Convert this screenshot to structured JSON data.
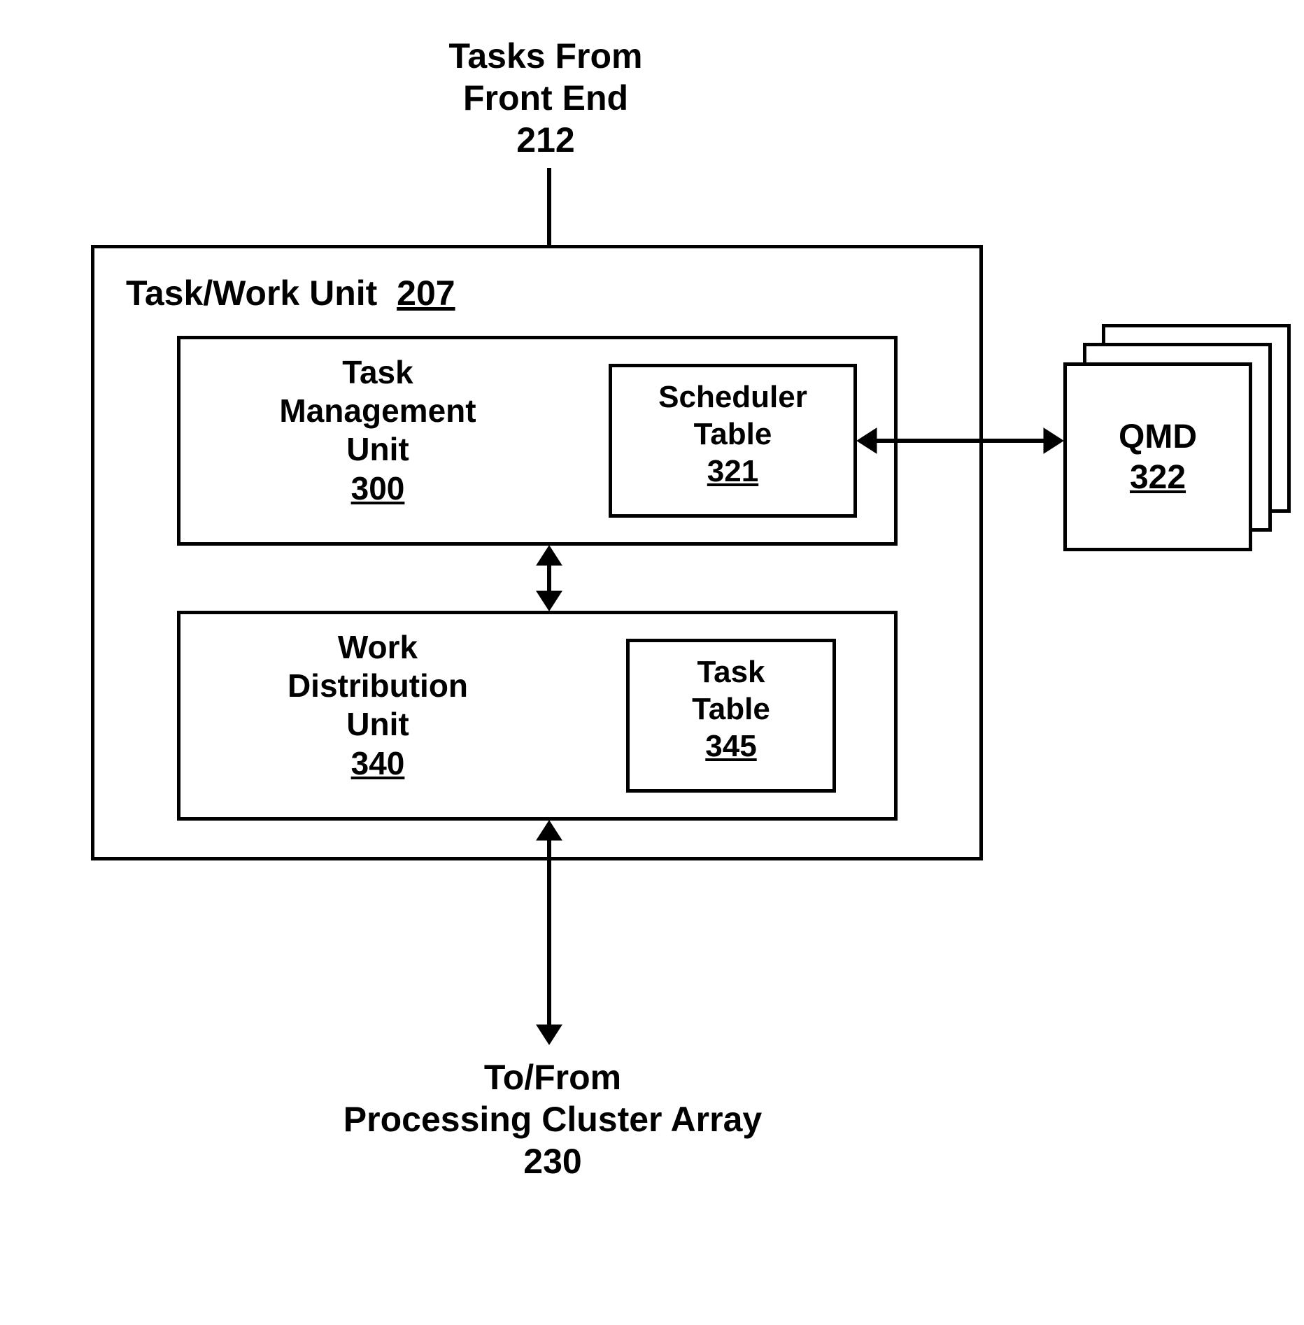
{
  "top_label": {
    "line1": "Tasks From",
    "line2": "Front End",
    "num": "212"
  },
  "bottom_label": {
    "line1": "To/From",
    "line2": "Processing Cluster Array",
    "num": "230"
  },
  "task_work_unit": {
    "title": "Task/Work Unit",
    "num": "207"
  },
  "tmu": {
    "line1": "Task",
    "line2": "Management",
    "line3": "Unit",
    "num": "300"
  },
  "sched": {
    "line1": "Scheduler",
    "line2": "Table",
    "num": "321"
  },
  "wdu": {
    "line1": "Work",
    "line2": "Distribution",
    "line3": "Unit",
    "num": "340"
  },
  "tasktable": {
    "line1": "Task",
    "line2": "Table",
    "num": "345"
  },
  "qmd": {
    "title": "QMD",
    "num": "322"
  }
}
